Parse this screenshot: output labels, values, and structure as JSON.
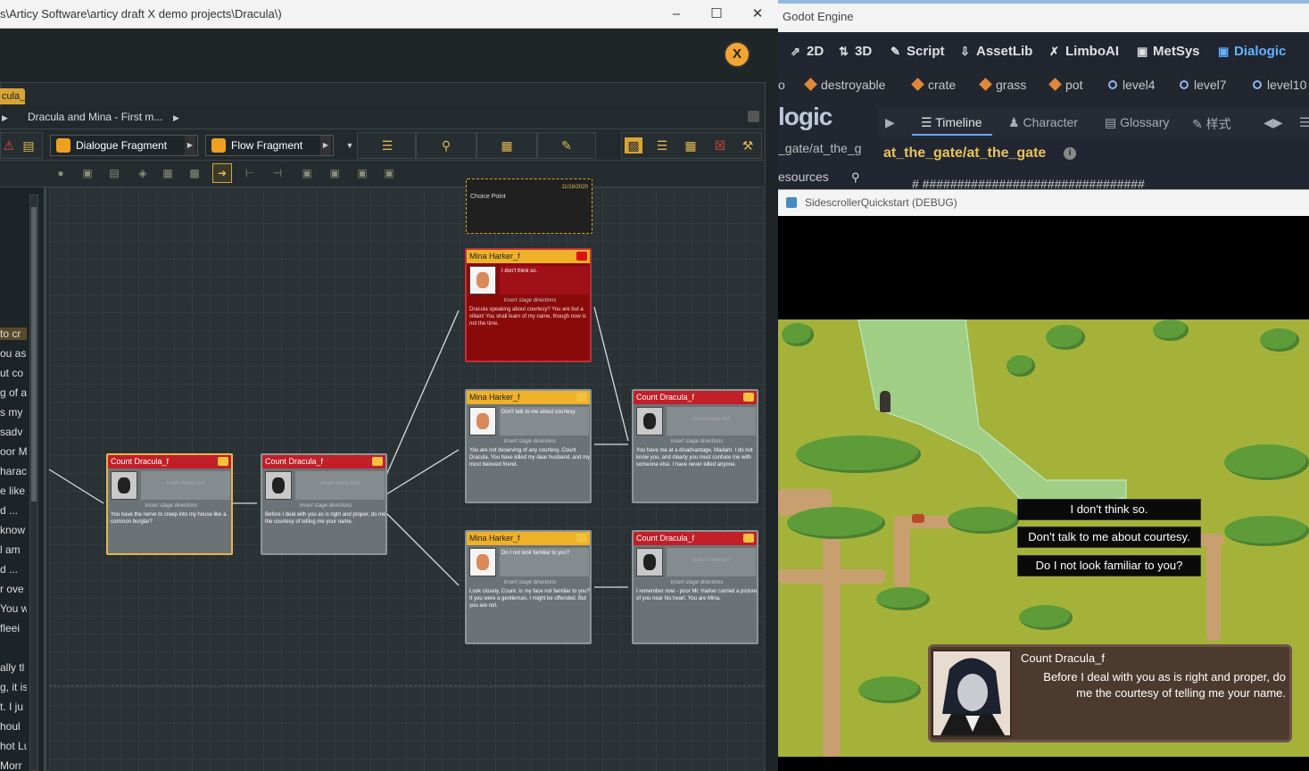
{
  "articy": {
    "title": "s\\Articy Software\\articy draft X demo projects\\Dracula\\)",
    "doc_tab": "cula_f",
    "breadcrumb": "Dracula and Mina - First m...",
    "toolbar": {
      "dialogue_fragment": "Dialogue Fragment",
      "flow_fragment": "Flow Fragment"
    },
    "strip_lines": [
      "to cr",
      "ou as",
      "ut co",
      "g of a",
      "s my",
      "sadv",
      "oor M",
      "harac",
      "e like",
      "d ...",
      "know",
      "l am",
      "d ...",
      "r ove",
      "You w",
      "fleei",
      "ally tl",
      "g, it is",
      "t. I ju",
      "houl",
      "hot Lu",
      "Morr"
    ],
    "nodes": {
      "choice_point": {
        "label": "Choice Point",
        "date": "11/18/2020"
      },
      "mina1": {
        "speaker": "Mina Harker_f",
        "menu": "I don't think so.",
        "text": "Dracula speaking about courtesy? You are but a villain! You shall learn of my name, though now is not the time."
      },
      "mina2": {
        "speaker": "Mina Harker_f",
        "menu": "Don't talk to me about courtesy.",
        "text": "You are not deserving of any courtesy, Count Dracula. You have killed my dear husband, and my most beloved friend."
      },
      "mina3": {
        "speaker": "Mina Harker_f",
        "menu": "Do I not look familiar to you?",
        "text": "Look closely, Count. Is my face not familiar to you? If you were a gentleman, I might be offended. But you are not."
      },
      "dracula1": {
        "speaker": "Count Dracula_f",
        "menu": "Insert menu text",
        "text": "You have the nerve to creep into my house like a common burglar?"
      },
      "dracula2": {
        "speaker": "Count Dracula_f",
        "menu": "Insert menu text",
        "text": "Before I deal with you as is right and proper, do me the courtesy of telling me your name."
      },
      "dracula3": {
        "speaker": "Count Dracula_f",
        "menu": "Insert menu text",
        "text": "You have me at a disadvantage, Madam. I do not know you, and clearly you must confuse me with someone else. I have never killed anyone."
      },
      "dracula4": {
        "speaker": "Count Dracula_f",
        "menu": "Insert menu text",
        "text": "I remember now - poor Mr. Harker carried a picture of you near his heart. You are Mina."
      },
      "stage_directions": "Insert stage directions"
    }
  },
  "godot": {
    "title": "Godot Engine",
    "main_tabs": [
      "2D",
      "3D",
      "Script",
      "AssetLib",
      "LimboAI",
      "MetSys",
      "Dialogic"
    ],
    "main_tab_icons": [
      "select-icon",
      "move-icon",
      "script-icon",
      "download-icon",
      "limbo-icon",
      "metsys-icon",
      "dialogic-icon"
    ],
    "resources": [
      "o",
      "destroyable",
      "crate",
      "grass",
      "pot",
      "level4",
      "level7",
      "level10"
    ],
    "dialogic_logo": "logic",
    "dialogic_tabs": [
      "Timeline",
      "Character",
      "Glossary",
      "样式"
    ],
    "timeline_path": "_gate/at_the_g",
    "timeline_title": "at_the_gate/at_the_gate",
    "resources_label": "esources",
    "hash_line": "#  ################################",
    "debug_title": "SidescrollerQuickstart (DEBUG)",
    "choices": [
      "I don't think so.",
      "Don't talk to me about courtesy.",
      "Do I not look familiar to you?"
    ],
    "speaker_name": "Count Dracula_f",
    "speaker_text": "Before I deal with you as is right and proper, do me the courtesy of telling me your name."
  }
}
